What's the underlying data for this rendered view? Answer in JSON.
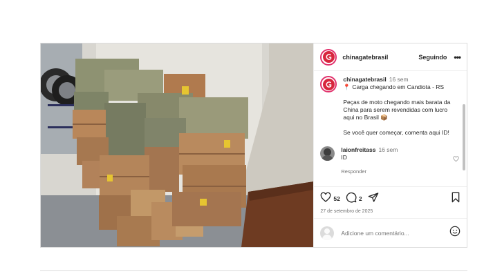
{
  "post": {
    "username": "chinagatebrasil",
    "follow_status": "Seguindo",
    "more_label": "•••",
    "caption": {
      "username": "chinagatebrasil",
      "time": "16 sem",
      "location_pin": "📍",
      "location_line": "Carga chegando em Candiota - RS",
      "paragraph1": "Peças de moto chegando mais barata da China para serem revendidas com lucro aqui no Brasil",
      "box_emoji": "📦",
      "paragraph2": "Se você quer começar, comenta aqui ID!"
    },
    "reply": {
      "username": "laionfreitass",
      "time": "16 sem",
      "text": "ID",
      "reply_label": "Responder"
    },
    "likes": "52",
    "comments_count": "2",
    "date": "27 de setembro de 2025",
    "add_comment_placeholder": "Adicione um comentário..."
  },
  "colors": {
    "brand_red": "#d7263d",
    "story_ring": "#e1306c",
    "muted": "#737373",
    "border": "#dbdbdb"
  },
  "icons": [
    "brand-logo-icon",
    "heart-icon",
    "comment-icon",
    "share-icon",
    "bookmark-icon",
    "emoji-icon",
    "like-comment-icon",
    "more-icon"
  ]
}
